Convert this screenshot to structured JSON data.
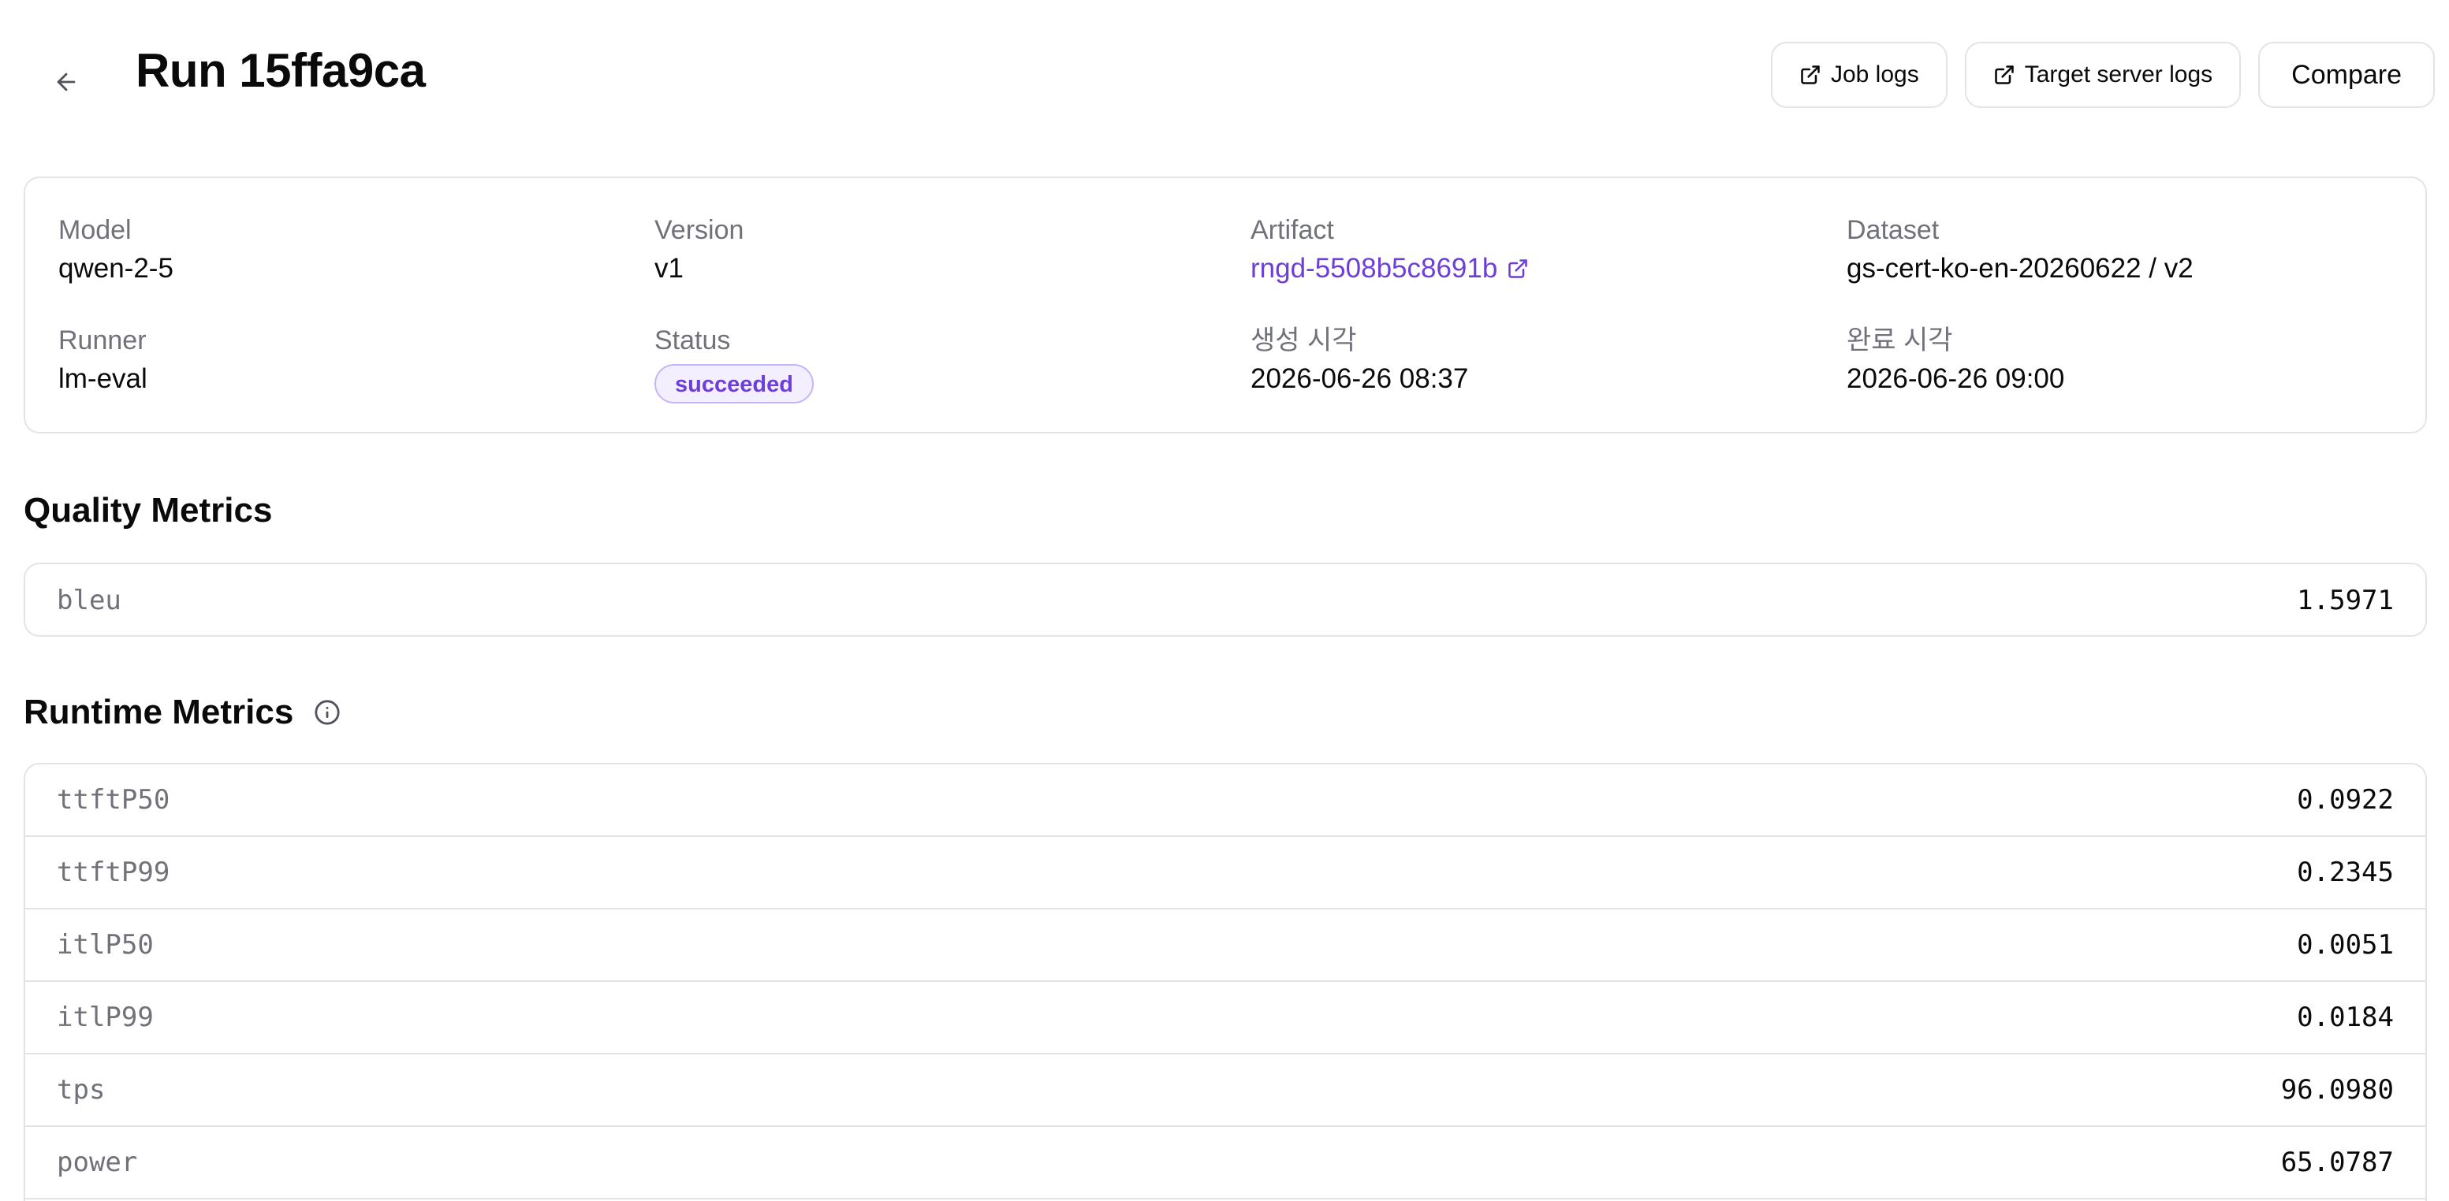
{
  "header": {
    "title": "Run 15ffa9ca",
    "buttons": {
      "job_logs": "Job logs",
      "target_server_logs": "Target server logs",
      "compare": "Compare"
    }
  },
  "info": {
    "model": {
      "label": "Model",
      "value": "qwen-2-5"
    },
    "version": {
      "label": "Version",
      "value": "v1"
    },
    "artifact": {
      "label": "Artifact",
      "value": "rngd-5508b5c8691b"
    },
    "dataset": {
      "label": "Dataset",
      "value": "gs-cert-ko-en-20260622 / v2"
    },
    "runner": {
      "label": "Runner",
      "value": "lm-eval"
    },
    "status": {
      "label": "Status",
      "value": "succeeded"
    },
    "created": {
      "label": "생성 시각",
      "value": "2026-06-26 08:37"
    },
    "completed": {
      "label": "완료 시각",
      "value": "2026-06-26 09:00"
    }
  },
  "quality": {
    "title": "Quality Metrics",
    "rows": [
      {
        "name": "bleu",
        "value": "1.5971"
      }
    ]
  },
  "runtime": {
    "title": "Runtime Metrics",
    "rows": [
      {
        "name": "ttftP50",
        "value": "0.0922"
      },
      {
        "name": "ttftP99",
        "value": "0.2345"
      },
      {
        "name": "itlP50",
        "value": "0.0051"
      },
      {
        "name": "itlP99",
        "value": "0.0184"
      },
      {
        "name": "tps",
        "value": "96.0980"
      },
      {
        "name": "power",
        "value": "65.0787"
      }
    ]
  },
  "colors": {
    "accent": "#6d3fd6",
    "border": "#e4e4e7",
    "muted_text": "#71717a",
    "badge_bg": "#f3efff"
  }
}
